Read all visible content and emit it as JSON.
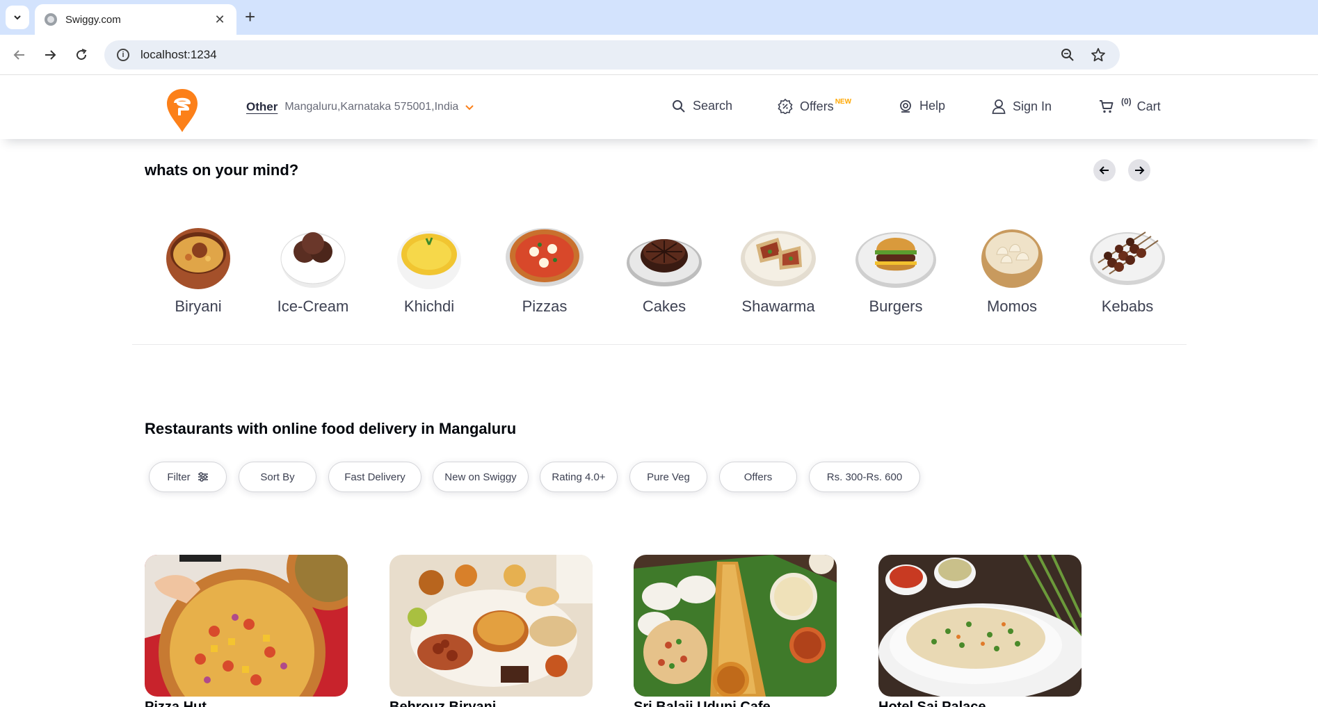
{
  "browser": {
    "tab_title": "Swiggy.com",
    "url": "localhost:1234"
  },
  "header": {
    "location_label": "Other",
    "address": "Mangaluru,Karnataka 575001,India",
    "nav": {
      "search": "Search",
      "offers": "Offers",
      "offers_badge": "NEW",
      "help": "Help",
      "sign_in": "Sign In",
      "cart_count": "(0)",
      "cart": "Cart"
    },
    "brand_color": "#fc8019"
  },
  "mind": {
    "title": "whats on your mind?",
    "categories": [
      {
        "label": "Biryani",
        "icon": "biryani-bowl"
      },
      {
        "label": "Ice-Cream",
        "icon": "ice-cream-bowl"
      },
      {
        "label": "Khichdi",
        "icon": "khichdi-bowl"
      },
      {
        "label": "Pizzas",
        "icon": "pizza-plate"
      },
      {
        "label": "Cakes",
        "icon": "cake-plate"
      },
      {
        "label": "Shawarma",
        "icon": "shawarma-plate"
      },
      {
        "label": "Burgers",
        "icon": "burger-plate"
      },
      {
        "label": "Momos",
        "icon": "momos-bowl"
      },
      {
        "label": "Kebabs",
        "icon": "kebab-plate"
      }
    ]
  },
  "restaurants": {
    "title": "Restaurants with online food delivery in Mangaluru",
    "filters": [
      "Filter",
      "Sort By",
      "Fast Delivery",
      "New on Swiggy",
      "Rating 4.0+",
      "Pure Veg",
      "Offers",
      "Rs. 300-Rs. 600"
    ],
    "cards": [
      {
        "image": "pizza-image",
        "name": "Pizza Hut"
      },
      {
        "image": "biryani-thali-image",
        "name": "Behrouz Biryani"
      },
      {
        "image": "dosa-idli-image",
        "name": "Sri Balaji Udupi Cafe"
      },
      {
        "image": "fried-rice-image",
        "name": "Hotel Sai Palace"
      }
    ]
  }
}
